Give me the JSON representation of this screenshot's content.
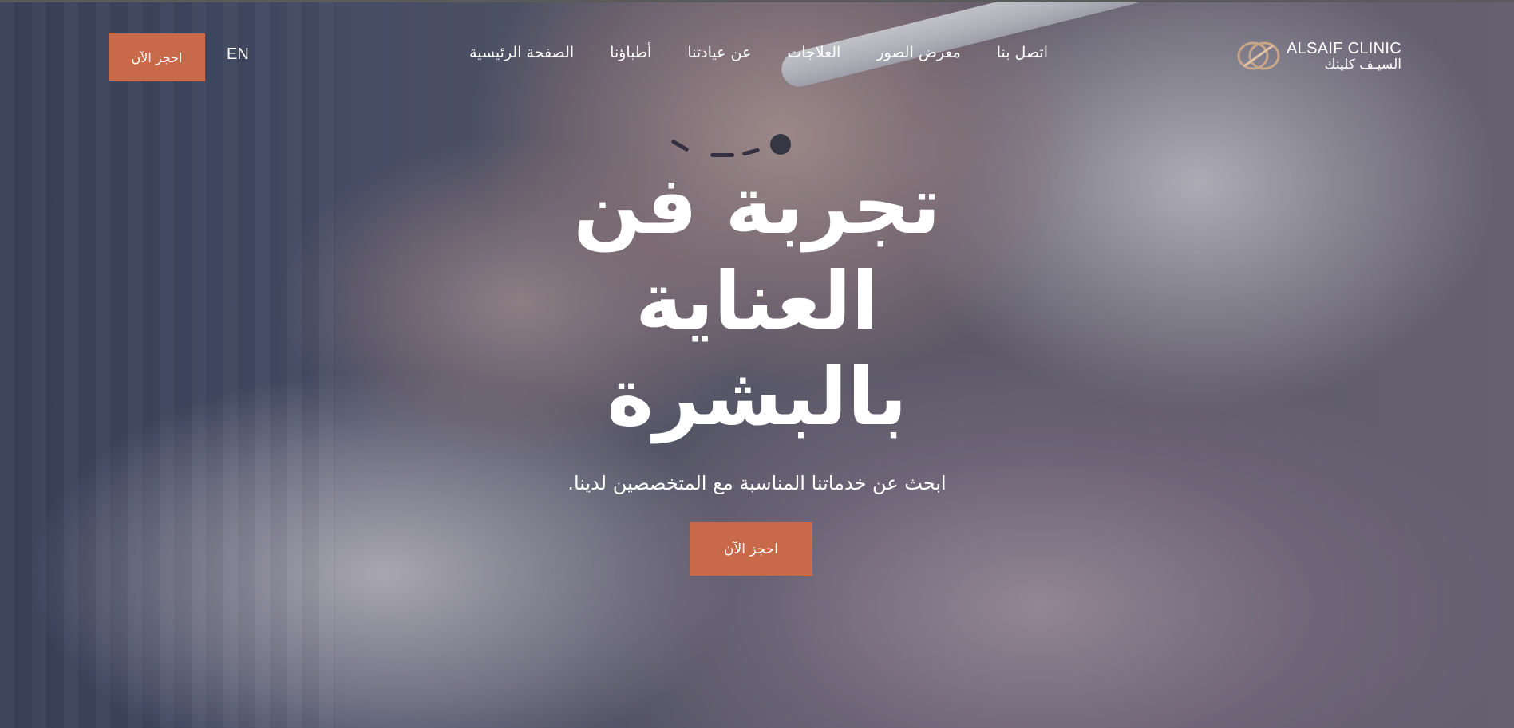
{
  "header": {
    "cta_label": "احجز الآن",
    "language_toggle": "EN",
    "nav": [
      {
        "label": "الصفحة الرئيسية"
      },
      {
        "label": "أطباؤنا"
      },
      {
        "label": "عن عيادتنا"
      },
      {
        "label": "العلاجات"
      },
      {
        "label": "معرض الصور"
      },
      {
        "label": "اتصل بنا"
      }
    ],
    "logo": {
      "en": "ALSAIF CLINIC",
      "ar": "السيـف كلينك"
    }
  },
  "hero": {
    "title_lines": [
      "تجربة فن",
      "العناية",
      "بالبشرة"
    ],
    "subtitle": "ابحث عن خدماتنا المناسبة مع المتخصصين لدينا.",
    "cta_label": "احجز الآن"
  },
  "colors": {
    "accent": "#c8694a",
    "text": "#ffffff"
  },
  "icons": {
    "logo_mark": "alsaif-logo-icon"
  }
}
